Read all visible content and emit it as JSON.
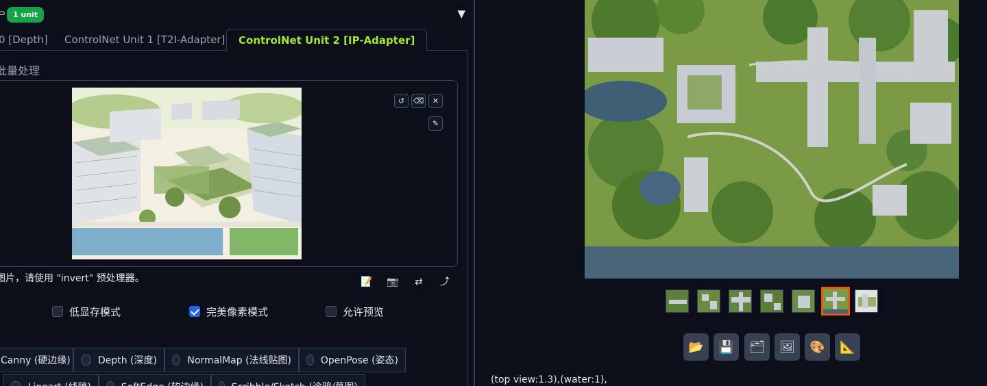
{
  "header": {
    "arrow_fragment": "⊃",
    "unit_badge": "1 unit",
    "collapse_icon": "▼"
  },
  "tabs": [
    {
      "label": "0 [Depth]",
      "active": false
    },
    {
      "label": "ControlNet Unit 1 [T2I-Adapter]",
      "active": false
    },
    {
      "label": "ControlNet Unit 2 [IP-Adapter]",
      "active": true
    }
  ],
  "batch_label": "批量处理",
  "image_tools": [
    "undo-icon",
    "eraser-icon",
    "close-icon",
    "brush-icon"
  ],
  "hint_text": "图片，请使用 \"invert\" 预处理器。",
  "action_icons": [
    "notepad-icon",
    "camera-icon",
    "swap-icon",
    "return-arrow-icon"
  ],
  "checkboxes": [
    {
      "label": "低显存模式",
      "checked": false
    },
    {
      "label": "完美像素模式",
      "checked": true
    },
    {
      "label": "允许预览",
      "checked": false
    }
  ],
  "preprocessor_row1": [
    {
      "label": "Canny (硬边缘)"
    },
    {
      "label": "Depth (深度)"
    },
    {
      "label": "NormalMap (法线贴图)"
    },
    {
      "label": "OpenPose (姿态)"
    }
  ],
  "preprocessor_row2": [
    {
      "label": "Lineart (线稿)"
    },
    {
      "label": "SoftEdge (软边缘)"
    },
    {
      "label": "Scribble/Sketch (涂鸦/草图)"
    }
  ],
  "gallery": {
    "thumbnail_count": 7,
    "selected_index": 5
  },
  "gallery_tools": [
    "folder-icon",
    "save-icon",
    "zip-icon",
    "image-icon",
    "palette-icon",
    "ruler-icon"
  ],
  "prompt_text": "(top view:1.3),(water:1),",
  "colors": {
    "accent_active_tab": "#a3e635",
    "badge": "#16a34a",
    "selected_thumb": "#ea580c",
    "checkbox_checked": "#2563eb"
  }
}
